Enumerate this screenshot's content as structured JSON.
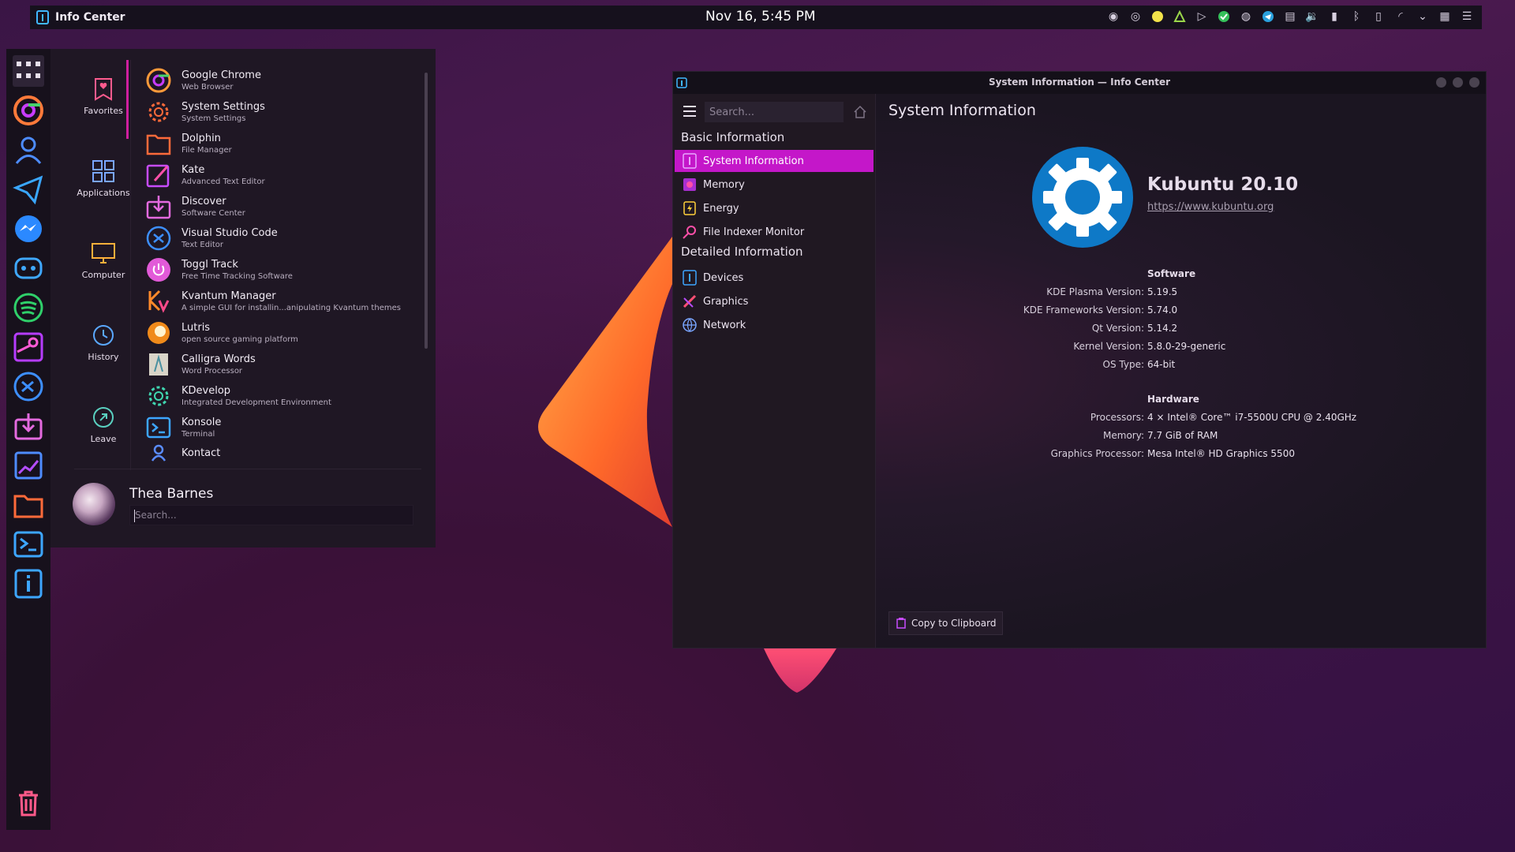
{
  "topbar": {
    "app_title": "Info Center",
    "clock": "Nov 16, 5:45 PM",
    "tray_icons": [
      "messenger-icon",
      "discord-icon",
      "yellow-dot-icon",
      "nvidia-icon",
      "play-icon",
      "check-icon",
      "steam-icon",
      "telegram-icon",
      "clipboard-icon",
      "volume-icon",
      "battery-icon",
      "bluetooth-icon",
      "phone-icon",
      "wifi-icon",
      "chevron-down-icon",
      "cpu-icon",
      "menu-icon"
    ]
  },
  "dock": {
    "items": [
      "apps-grid-icon",
      "chrome-icon",
      "contacts-icon",
      "telegram-icon",
      "messenger-icon",
      "discord-icon",
      "spotify-icon",
      "steam-icon",
      "vscode-icon",
      "discover-icon",
      "krita-icon",
      "folder-icon",
      "konsole-icon",
      "info-icon",
      "trash-icon"
    ]
  },
  "launcher": {
    "categories": [
      {
        "label": "Favorites"
      },
      {
        "label": "Applications"
      },
      {
        "label": "Computer"
      },
      {
        "label": "History"
      },
      {
        "label": "Leave"
      }
    ],
    "apps": [
      {
        "name": "Google Chrome",
        "desc": "Web Browser"
      },
      {
        "name": "System Settings",
        "desc": "System Settings"
      },
      {
        "name": "Dolphin",
        "desc": "File Manager"
      },
      {
        "name": "Kate",
        "desc": "Advanced Text Editor"
      },
      {
        "name": "Discover",
        "desc": "Software Center"
      },
      {
        "name": "Visual Studio Code",
        "desc": "Text Editor"
      },
      {
        "name": "Toggl Track",
        "desc": "Free Time Tracking Software"
      },
      {
        "name": "Kvantum Manager",
        "desc": "A simple GUI for installin...anipulating Kvantum themes"
      },
      {
        "name": "Lutris",
        "desc": "open source gaming platform"
      },
      {
        "name": "Calligra Words",
        "desc": "Word Processor"
      },
      {
        "name": "KDevelop",
        "desc": "Integrated Development Environment"
      },
      {
        "name": "Konsole",
        "desc": "Terminal"
      },
      {
        "name": "Kontact",
        "desc": ""
      }
    ],
    "user_name": "Thea Barnes",
    "search_placeholder": "Search..."
  },
  "window": {
    "title": "System Information — Info Center",
    "sidebar": {
      "search_placeholder": "Search...",
      "basic_header": "Basic Information",
      "basic_items": [
        "System Information",
        "Memory",
        "Energy",
        "File Indexer Monitor"
      ],
      "detailed_header": "Detailed Information",
      "detailed_items": [
        "Devices",
        "Graphics",
        "Network"
      ]
    },
    "content": {
      "title": "System Information",
      "distro_name": "Kubuntu 20.10",
      "distro_url": "https://www.kubuntu.org",
      "software_header": "Software",
      "software": [
        {
          "k": "KDE Plasma Version:",
          "v": "5.19.5"
        },
        {
          "k": "KDE Frameworks Version:",
          "v": "5.74.0"
        },
        {
          "k": "Qt Version:",
          "v": "5.14.2"
        },
        {
          "k": "Kernel Version:",
          "v": "5.8.0-29-generic"
        },
        {
          "k": "OS Type:",
          "v": "64-bit"
        }
      ],
      "hardware_header": "Hardware",
      "hardware": [
        {
          "k": "Processors:",
          "v": "4 × Intel® Core™ i7-5500U CPU @ 2.40GHz"
        },
        {
          "k": "Memory:",
          "v": "7.7 GiB of RAM"
        },
        {
          "k": "Graphics Processor:",
          "v": "Mesa Intel® HD Graphics 5500"
        }
      ],
      "copy_label": "Copy to Clipboard"
    }
  }
}
